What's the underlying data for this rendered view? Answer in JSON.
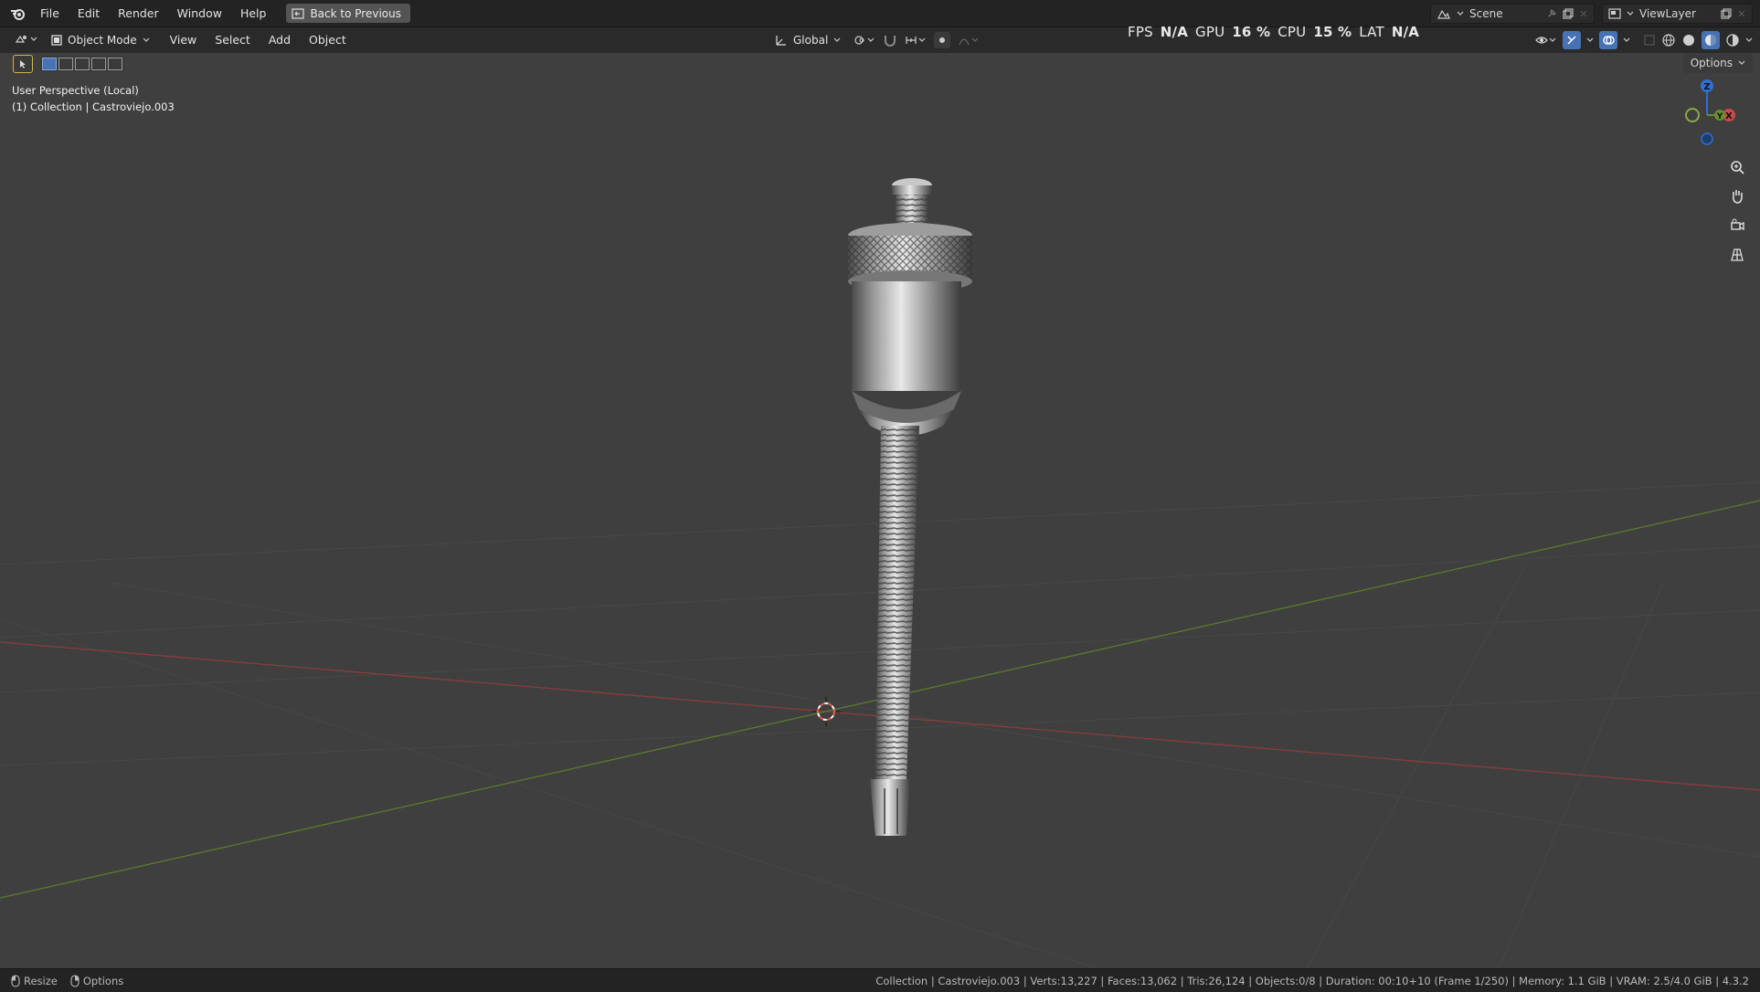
{
  "topbar": {
    "menu": [
      "File",
      "Edit",
      "Render",
      "Window",
      "Help"
    ],
    "back_label": "Back to Previous",
    "scene_label": "Scene",
    "viewlayer_label": "ViewLayer"
  },
  "header": {
    "mode_label": "Object Mode",
    "menus": [
      "View",
      "Select",
      "Add",
      "Object"
    ],
    "transform_orientation": "Global",
    "options_label": "Options"
  },
  "perf": {
    "fps_label": "FPS",
    "fps_value": "N/A",
    "gpu_label": "GPU",
    "gpu_value": "16 %",
    "cpu_label": "CPU",
    "cpu_value": "15 %",
    "lat_label": "LAT",
    "lat_value": "N/A"
  },
  "viewport": {
    "view_name": "User Perspective (Local)",
    "collection_line": "(1) Collection | Castroviejo.003"
  },
  "gizmo": {
    "z": "Z",
    "x": "X",
    "y": "Y"
  },
  "status": {
    "resize": "Resize",
    "options": "Options",
    "info": "Collection | Castroviejo.003 | Verts:13,227 | Faces:13,062 | Tris:26,124 | Objects:0/8 | Duration: 00:10+10 (Frame 1/250) | Memory: 1.1 GiB | VRAM: 2.5/4.0 GiB | 4.3.2"
  },
  "colors": {
    "x_axis": "#c94a4a",
    "y_axis": "#6a8f2e",
    "z_axis": "#2f6fd6",
    "accent": "#4772b3"
  }
}
